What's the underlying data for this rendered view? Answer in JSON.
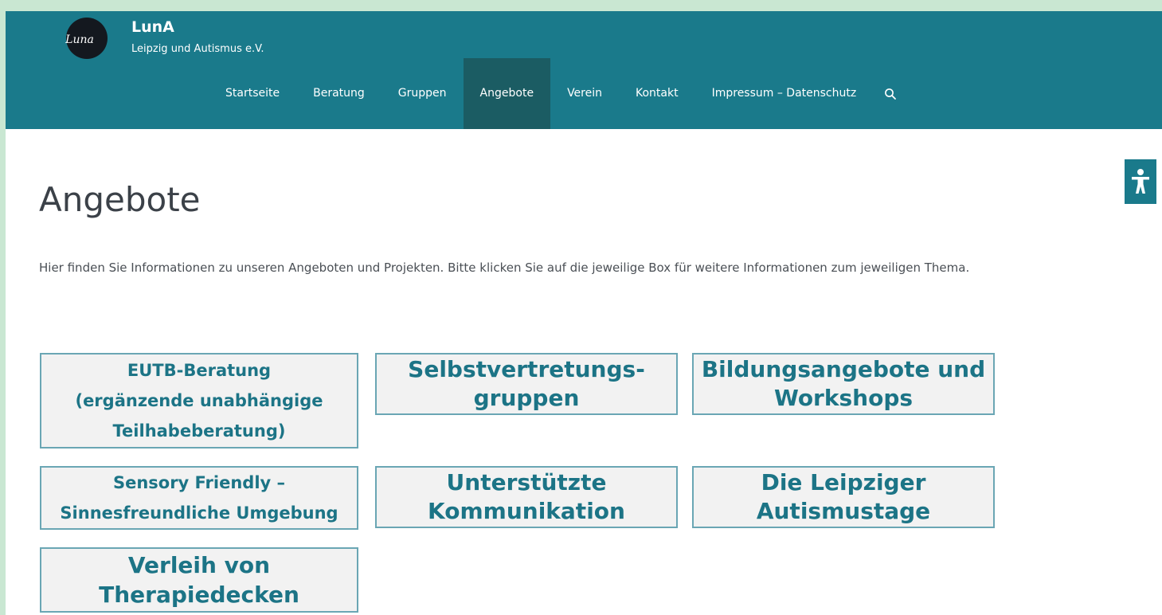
{
  "site": {
    "name": "LunA",
    "tagline": "Leipzig und Autismus e.V."
  },
  "nav": {
    "items": [
      {
        "label": "Startseite"
      },
      {
        "label": "Beratung"
      },
      {
        "label": "Gruppen"
      },
      {
        "label": "Angebote",
        "active": true
      },
      {
        "label": "Verein"
      },
      {
        "label": "Kontakt"
      },
      {
        "label": "Impressum – Datenschutz"
      }
    ],
    "search_icon": "search-icon"
  },
  "accessibility_icon": "accessibility-icon",
  "page": {
    "title": "Angebote",
    "intro": "Hier finden Sie Informationen zu unseren Angeboten und Projekten. Bitte klicken Sie auf die jeweilige Box für weitere Informationen zum jeweiligen Thema."
  },
  "boxes": [
    {
      "lines": [
        "EUTB-Beratung",
        "(ergänzende unabhängige",
        "Teilhabeberatung)"
      ]
    },
    {
      "lines": [
        "Selbstvertretungs-",
        "gruppen"
      ]
    },
    {
      "lines": [
        "Bildungsangebote und",
        "Workshops"
      ]
    },
    {
      "lines": [
        "Sensory Friendly –",
        "Sinnesfreundliche Umgebung"
      ]
    },
    {
      "lines": [
        "Unterstützte",
        "Kommunikation"
      ]
    },
    {
      "lines": [
        "Die Leipziger",
        "Autismustage"
      ]
    },
    {
      "lines": [
        "Verleih von",
        "Therapiedecken"
      ]
    }
  ],
  "colors": {
    "header": "#1a7a8b",
    "nav_active": "#1b5c63",
    "box_text": "#1c7486",
    "box_border": "#6aa6b4",
    "box_bg": "#f2f2f2",
    "outer_bg": "#c9e7d2"
  }
}
